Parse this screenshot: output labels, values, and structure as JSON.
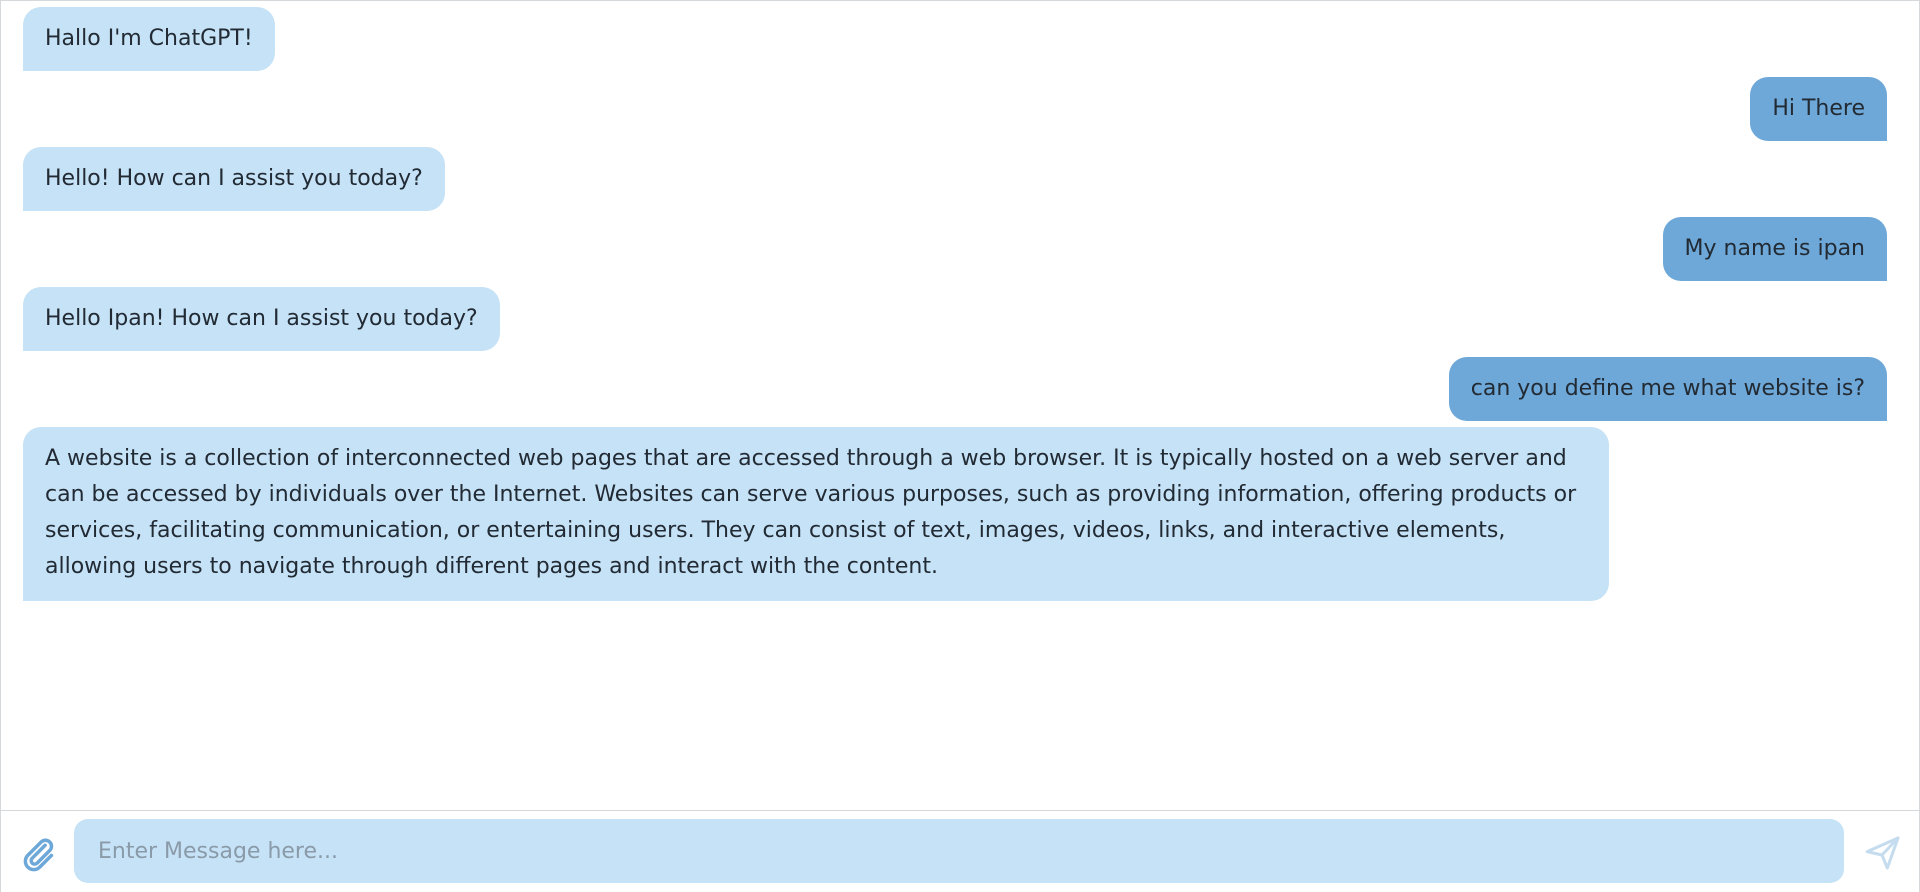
{
  "theme": {
    "bot_bubble_color": "#c5e2f7",
    "user_bubble_color": "#6ea8d8",
    "icon_color": "#6ea8d8"
  },
  "messages": [
    {
      "sender": "bot",
      "text": "Hallo I'm ChatGPT!"
    },
    {
      "sender": "user",
      "text": "Hi There"
    },
    {
      "sender": "bot",
      "text": "Hello! How can I assist you today?"
    },
    {
      "sender": "user",
      "text": "My name is ipan"
    },
    {
      "sender": "bot",
      "text": "Hello Ipan! How can I assist you today?"
    },
    {
      "sender": "user",
      "text": "can you define me what website is?"
    },
    {
      "sender": "bot",
      "text": "A website is a collection of interconnected web pages that are accessed through a web browser. It is typically hosted on a web server and can be accessed by individuals over the Internet. Websites can serve various purposes, such as providing information, offering products or services, facilitating communication, or entertaining users. They can consist of text, images, videos, links, and interactive elements, allowing users to navigate through different pages and interact with the content."
    }
  ],
  "composer": {
    "placeholder": "Enter Message here...",
    "value": "",
    "attach_icon": "paperclip-icon",
    "send_icon": "send-icon"
  }
}
